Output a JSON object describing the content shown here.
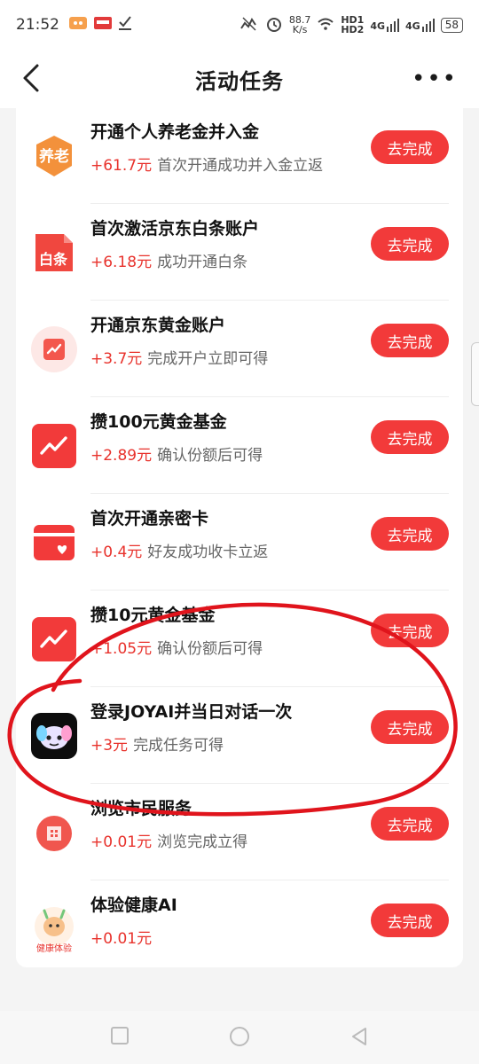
{
  "status_bar": {
    "time": "21:52",
    "net_speed": "88.7",
    "net_unit": "K/s",
    "hd1": "HD1",
    "hd2": "HD2",
    "net1": "4G",
    "net2": "4G",
    "battery": "58"
  },
  "header": {
    "title": "活动任务",
    "more": "•••"
  },
  "tasks": [
    {
      "name": "开通个人养老金并入金",
      "reward": "+61.7元",
      "desc": "首次开通成功并入金立返",
      "button": "去完成",
      "icon": "pension-icon",
      "icon_text": "养老"
    },
    {
      "name": "首次激活京东白条账户",
      "reward": "+6.18元",
      "desc": "成功开通白条",
      "button": "去完成",
      "icon": "baitiao-icon",
      "icon_text": "白条"
    },
    {
      "name": "开通京东黄金账户",
      "reward": "+3.7元",
      "desc": "完成开户立即可得",
      "button": "去完成",
      "icon": "gold-account-icon"
    },
    {
      "name": "攒100元黄金基金",
      "reward": "+2.89元",
      "desc": "确认份额后可得",
      "button": "去完成",
      "icon": "fund-chart-icon"
    },
    {
      "name": "首次开通亲密卡",
      "reward": "+0.4元",
      "desc": "好友成功收卡立返",
      "button": "去完成",
      "icon": "intimate-card-icon"
    },
    {
      "name": "攒10元黄金基金",
      "reward": "+1.05元",
      "desc": "确认份额后可得",
      "button": "去完成",
      "icon": "fund-chart-icon"
    },
    {
      "name": "登录JOYAI并当日对话一次",
      "reward": "+3元",
      "desc": "完成任务可得",
      "button": "去完成",
      "icon": "joyai-icon"
    },
    {
      "name": "浏览市民服务",
      "reward": "+0.01元",
      "desc": "浏览完成立得",
      "button": "去完成",
      "icon": "citizen-service-icon"
    },
    {
      "name": "体验健康AI",
      "reward": "+0.01元",
      "desc": "",
      "button": "去完成",
      "icon": "health-ai-icon",
      "icon_text": "健康体验"
    }
  ],
  "colors": {
    "accent": "#f23a3a",
    "reward": "#e8322c",
    "annotation": "#e0141c"
  }
}
